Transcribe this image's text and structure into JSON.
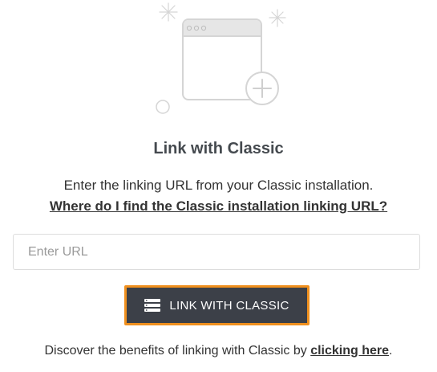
{
  "illustration": {
    "icon": "browser-window-add-icon",
    "colors": {
      "outline": "#d5d5d5",
      "titlebar": "#e6e6e6"
    }
  },
  "title": "Link with Classic",
  "description": "Enter the linking URL from your Classic installation.",
  "help_link": "Where do I find the Classic installation linking URL?",
  "url_input": {
    "placeholder": "Enter URL",
    "value": ""
  },
  "link_button": {
    "label": "LINK WITH CLASSIC",
    "icon": "server-icon",
    "background": "#3c4048",
    "border_color": "#f0901e"
  },
  "footer": {
    "text_before": "Discover the benefits of linking with Classic by ",
    "link_text": "clicking here",
    "text_after": "."
  }
}
